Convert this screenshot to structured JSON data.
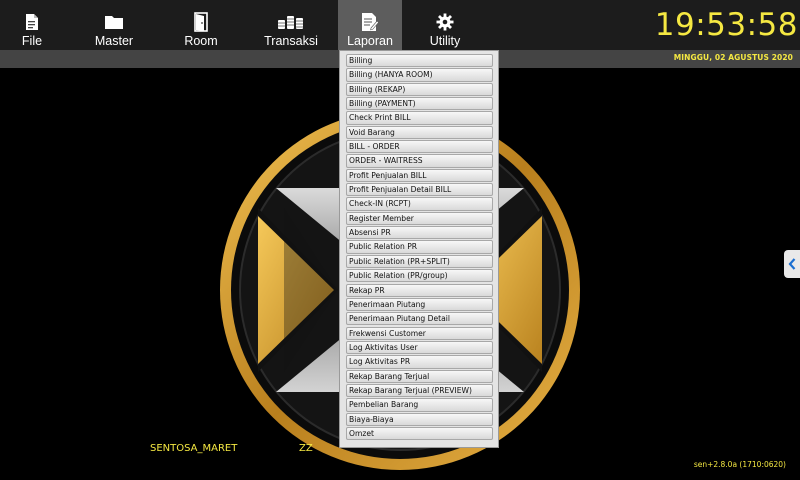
{
  "nav": {
    "file": "File",
    "master": "Master",
    "room": "Room",
    "transaksi": "Transaksi",
    "laporan": "Laporan",
    "utility": "Utility"
  },
  "clock": "19:53:58",
  "date": "MINGGU, 02 AGUSTUS 2020",
  "laporan_menu": [
    "Billing",
    "Billing (HANYA ROOM)",
    "Billing (REKAP)",
    "Billing (PAYMENT)",
    "Check Print BILL",
    "Void Barang",
    "BILL - ORDER",
    "ORDER - WAITRESS",
    "Profit Penjualan BILL",
    "Profit Penjualan Detail BILL",
    "Check-IN (RCPT)",
    "Register Member",
    "Absensi PR",
    "Public Relation PR",
    "Public Relation (PR+SPLIT)",
    "Public Relation (PR/group)",
    "Rekap PR",
    "Penerimaan Piutang",
    "Penerimaan Piutang Detail",
    "Frekwensi Customer",
    "Log Aktivitas User",
    "Log Aktivitas PR",
    "Rekap Barang Terjual",
    "Rekap Barang Terjual (PREVIEW)",
    "Pembelian Barang",
    "Biaya-Biaya",
    "Omzet"
  ],
  "footer": {
    "outlet": "SENTOSA_MARET",
    "user": "ZZ",
    "version": "sen+2.8.0a (1710:0620)"
  },
  "colors": {
    "accent_yellow": "#f5e842",
    "toolbar_bg": "#1c1c1c",
    "active_tab": "#5d5d5d",
    "gold": "#d9a43a"
  }
}
